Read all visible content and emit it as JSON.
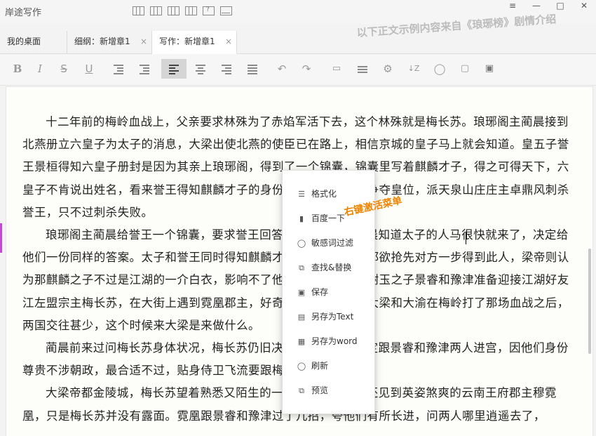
{
  "app": {
    "title": "岸途写作"
  },
  "window_controls": {
    "menu": "≡",
    "minimize": "—",
    "maximize": "□",
    "close": "✕"
  },
  "tabs": [
    {
      "label": "我的桌面",
      "closable": false,
      "active": false
    },
    {
      "label": "细纲：新增章1",
      "closable": true,
      "active": false
    },
    {
      "label": "写作：新增章1",
      "closable": true,
      "active": true
    }
  ],
  "tab_close_glyph": "×",
  "promo_text": "以下正文示例内容来自《琅琊榜》剧情介绍",
  "toolbar": {
    "bold": "B",
    "italic": "I",
    "strike": "S",
    "underline": "U",
    "undo": "↶",
    "redo": "↷",
    "refresh": "◯",
    "sort": "↓Z",
    "active_tool": "align-left",
    "icons": [
      "outdent-icon",
      "indent-icon",
      "align-left-icon",
      "align-center-icon",
      "align-right-icon",
      "align-justify-icon",
      "undo-icon",
      "redo-icon",
      "card-icon",
      "list-icon",
      "settings-icon",
      "sort-icon",
      "refresh-icon",
      "save-icon",
      "save-as-icon"
    ]
  },
  "editor": {
    "paragraphs": [
      "十二年前的梅岭血战上，父亲要求林殊为了赤焰军活下去，这个林殊就是梅长苏。琅琊阁主蔺晨接到北燕册立六皇子为太子的消息，大梁出使北燕的使臣已在路上，相信京城的皇子马上就会知道。皇五子誉王景桓得知六皇子册封是因为其亲上琅琊阁，得到了一个锦囊，锦囊里写着麒麟才子，得之可得天下，六皇子不肯说出姓名，看来誉王得知麒麟才子的身份，与太子和誉王争夺皇位，派天泉山庄庄主卓鼎风刺杀誉王，只不过刺杀失败。",
      "琅琊阁主蔺晨给誉王一个锦囊，要求誉王回答同一个问题，蔺晨知道太子的人马很快就来了，决定给他们一份同样的答案。太子和誉王同时得知麒麟才子就是梅长苏，都欲抢先对方一步得到此人，梁帝则认为那麒麟之子不过是江湖的一介白衣，影响不了他的天下。宁国侯谢玉之子景睿和豫津准备迎接江湖好友江左盟宗主梅长苏，在大街上遇到霓凰郡主，好奇自从十二年前，大梁和大渝在梅岭打了那场血战之后，两国交往甚少，这个时候来大梁是来做什么。",
      "蔺晨前来过问梅长苏身体状况，梅长苏仍旧决定与誉王联手，定跟景睿和豫津两人进宫，因他们身份尊贵不涉朝政，最合适不过，贴身侍卫飞流要跟梅长苏一同去金陵。",
      "大梁帝都金陵城，梅长苏望着熟悉又陌生的一切，回想起当年还见到英姿煞爽的云南王府郡主穆霓凰，只是梅长苏并没有露面。霓凰跟景睿和豫津过了几招，夸他们有所长进，问两人哪里逍遥去了，"
    ]
  },
  "context_menu": {
    "items": [
      {
        "label": "格式化",
        "icon": "format-icon",
        "glyph": "☰"
      },
      {
        "label": "百度一下",
        "icon": "bookmark-icon",
        "glyph": "▮"
      },
      {
        "label": "敏感词过滤",
        "icon": "circle-icon",
        "glyph": "◯"
      },
      {
        "label": "查找&替换",
        "icon": "copy-icon",
        "glyph": "⧉"
      },
      {
        "label": "保存",
        "icon": "save-icon",
        "glyph": "▣"
      },
      {
        "label": "另存为Text",
        "icon": "text-file-icon",
        "glyph": "▤"
      },
      {
        "label": "另存为word",
        "icon": "word-file-icon",
        "glyph": "▦"
      },
      {
        "label": "刷新",
        "icon": "refresh-icon",
        "glyph": "◯"
      },
      {
        "label": "预览",
        "icon": "preview-icon",
        "glyph": "⧉"
      }
    ]
  },
  "annotation": "右键激活菜单",
  "colors": {
    "accent_marker": "#c04ad1",
    "annotation": "#f08400",
    "active_tool_bg": "#d5d5d5"
  }
}
